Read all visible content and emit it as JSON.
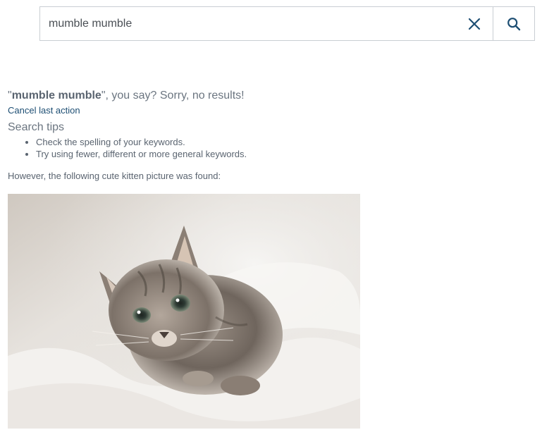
{
  "search": {
    "value": "mumble mumble",
    "clear_icon": "close-icon",
    "submit_icon": "search-icon"
  },
  "results": {
    "query_open_quote": "\"",
    "query": "mumble mumble",
    "message_suffix": "\", you say? Sorry, no results!",
    "cancel_label": "Cancel last action",
    "tips_heading": "Search tips",
    "tips": [
      "Check the spelling of your keywords.",
      "Try using fewer, different or more general keywords."
    ],
    "found_text": "However, the following cute kitten picture was found:"
  },
  "colors": {
    "link": "#1d4e73",
    "icon": "#1d4e73",
    "border": "#c9ced3",
    "text": "#5a6470"
  }
}
